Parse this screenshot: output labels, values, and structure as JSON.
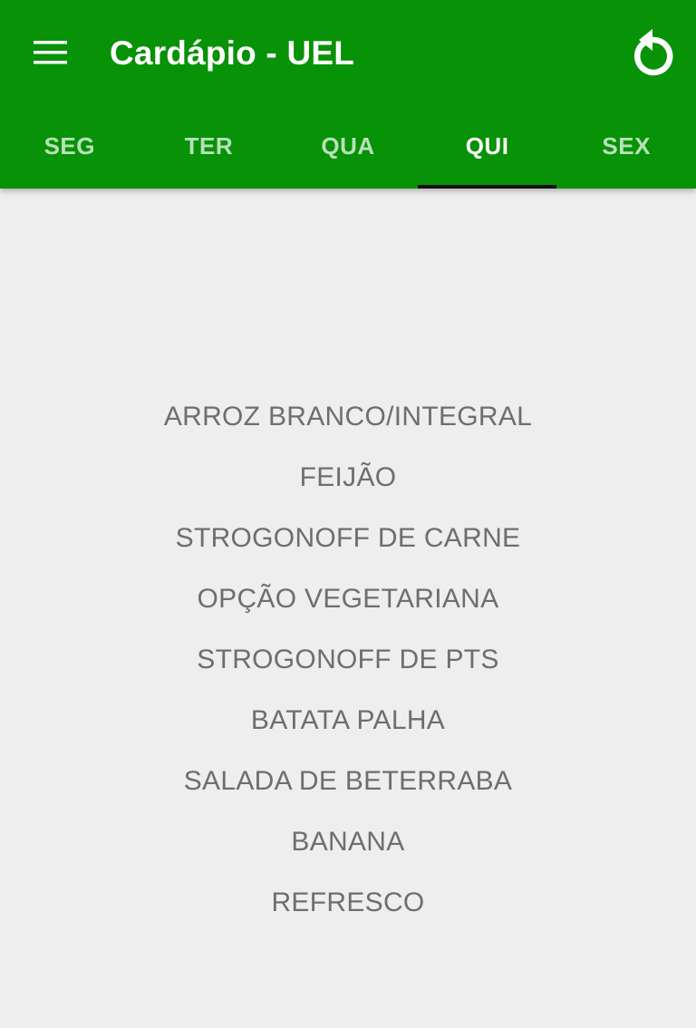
{
  "app": {
    "title": "Cardápio - UEL",
    "colors": {
      "appbar": "#079207",
      "background": "#eeeeee",
      "text": "#6e6e6e",
      "tab_indicator": "#111111"
    },
    "icons": {
      "menu": "hamburger-menu-icon",
      "refresh": "refresh-icon"
    }
  },
  "tabs": [
    {
      "label": "SEG",
      "active": false
    },
    {
      "label": "TER",
      "active": false
    },
    {
      "label": "QUA",
      "active": false
    },
    {
      "label": "QUI",
      "active": true
    },
    {
      "label": "SEX",
      "active": false
    }
  ],
  "menu": {
    "items": [
      "ARROZ BRANCO/INTEGRAL",
      "FEIJÃO",
      "STROGONOFF DE CARNE",
      "OPÇÃO VEGETARIANA",
      "STROGONOFF DE PTS",
      "BATATA PALHA",
      "SALADA DE BETERRABA",
      "BANANA",
      "REFRESCO"
    ]
  }
}
